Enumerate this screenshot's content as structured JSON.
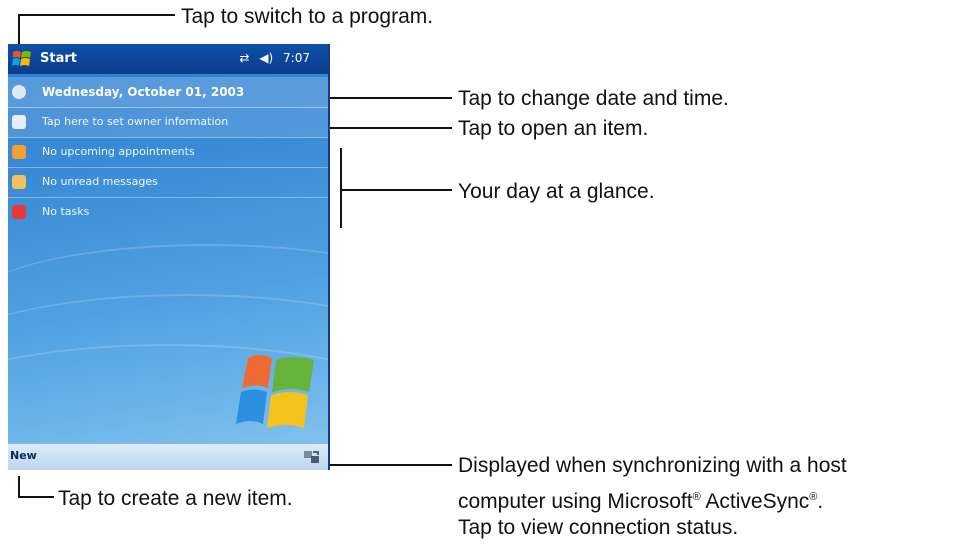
{
  "device": {
    "taskbar": {
      "start_label": "Start",
      "time": "7:07"
    },
    "today_items": [
      {
        "name": "date",
        "label": "Wednesday, October 01, 2003"
      },
      {
        "name": "owner",
        "label": "Tap here to set owner information"
      },
      {
        "name": "appointments",
        "label": "No upcoming appointments"
      },
      {
        "name": "messages",
        "label": "No unread messages"
      },
      {
        "name": "tasks",
        "label": "No tasks"
      }
    ],
    "command_bar": {
      "new_label": "New"
    }
  },
  "callouts": {
    "switch_program": "Tap to switch to a program.",
    "change_date": "Tap to change date and time.",
    "open_item": "Tap to open an item.",
    "day_glance": "Your day at a glance.",
    "sync_line1": "Displayed when synchronizing with a host",
    "sync_line2_a": "computer using Microsoft",
    "sync_line2_b": " ActiveSync",
    "sync_line2_c": ".",
    "reg": "®",
    "sync_line3": "Tap to view connection status.",
    "create_new": "Tap to create a new item."
  },
  "colors": {
    "taskbar": "#0e4fa8",
    "screen_top": "#2f7fd0",
    "screen_bottom": "#8ac7ef",
    "command_bar": "#bcd6ef"
  }
}
